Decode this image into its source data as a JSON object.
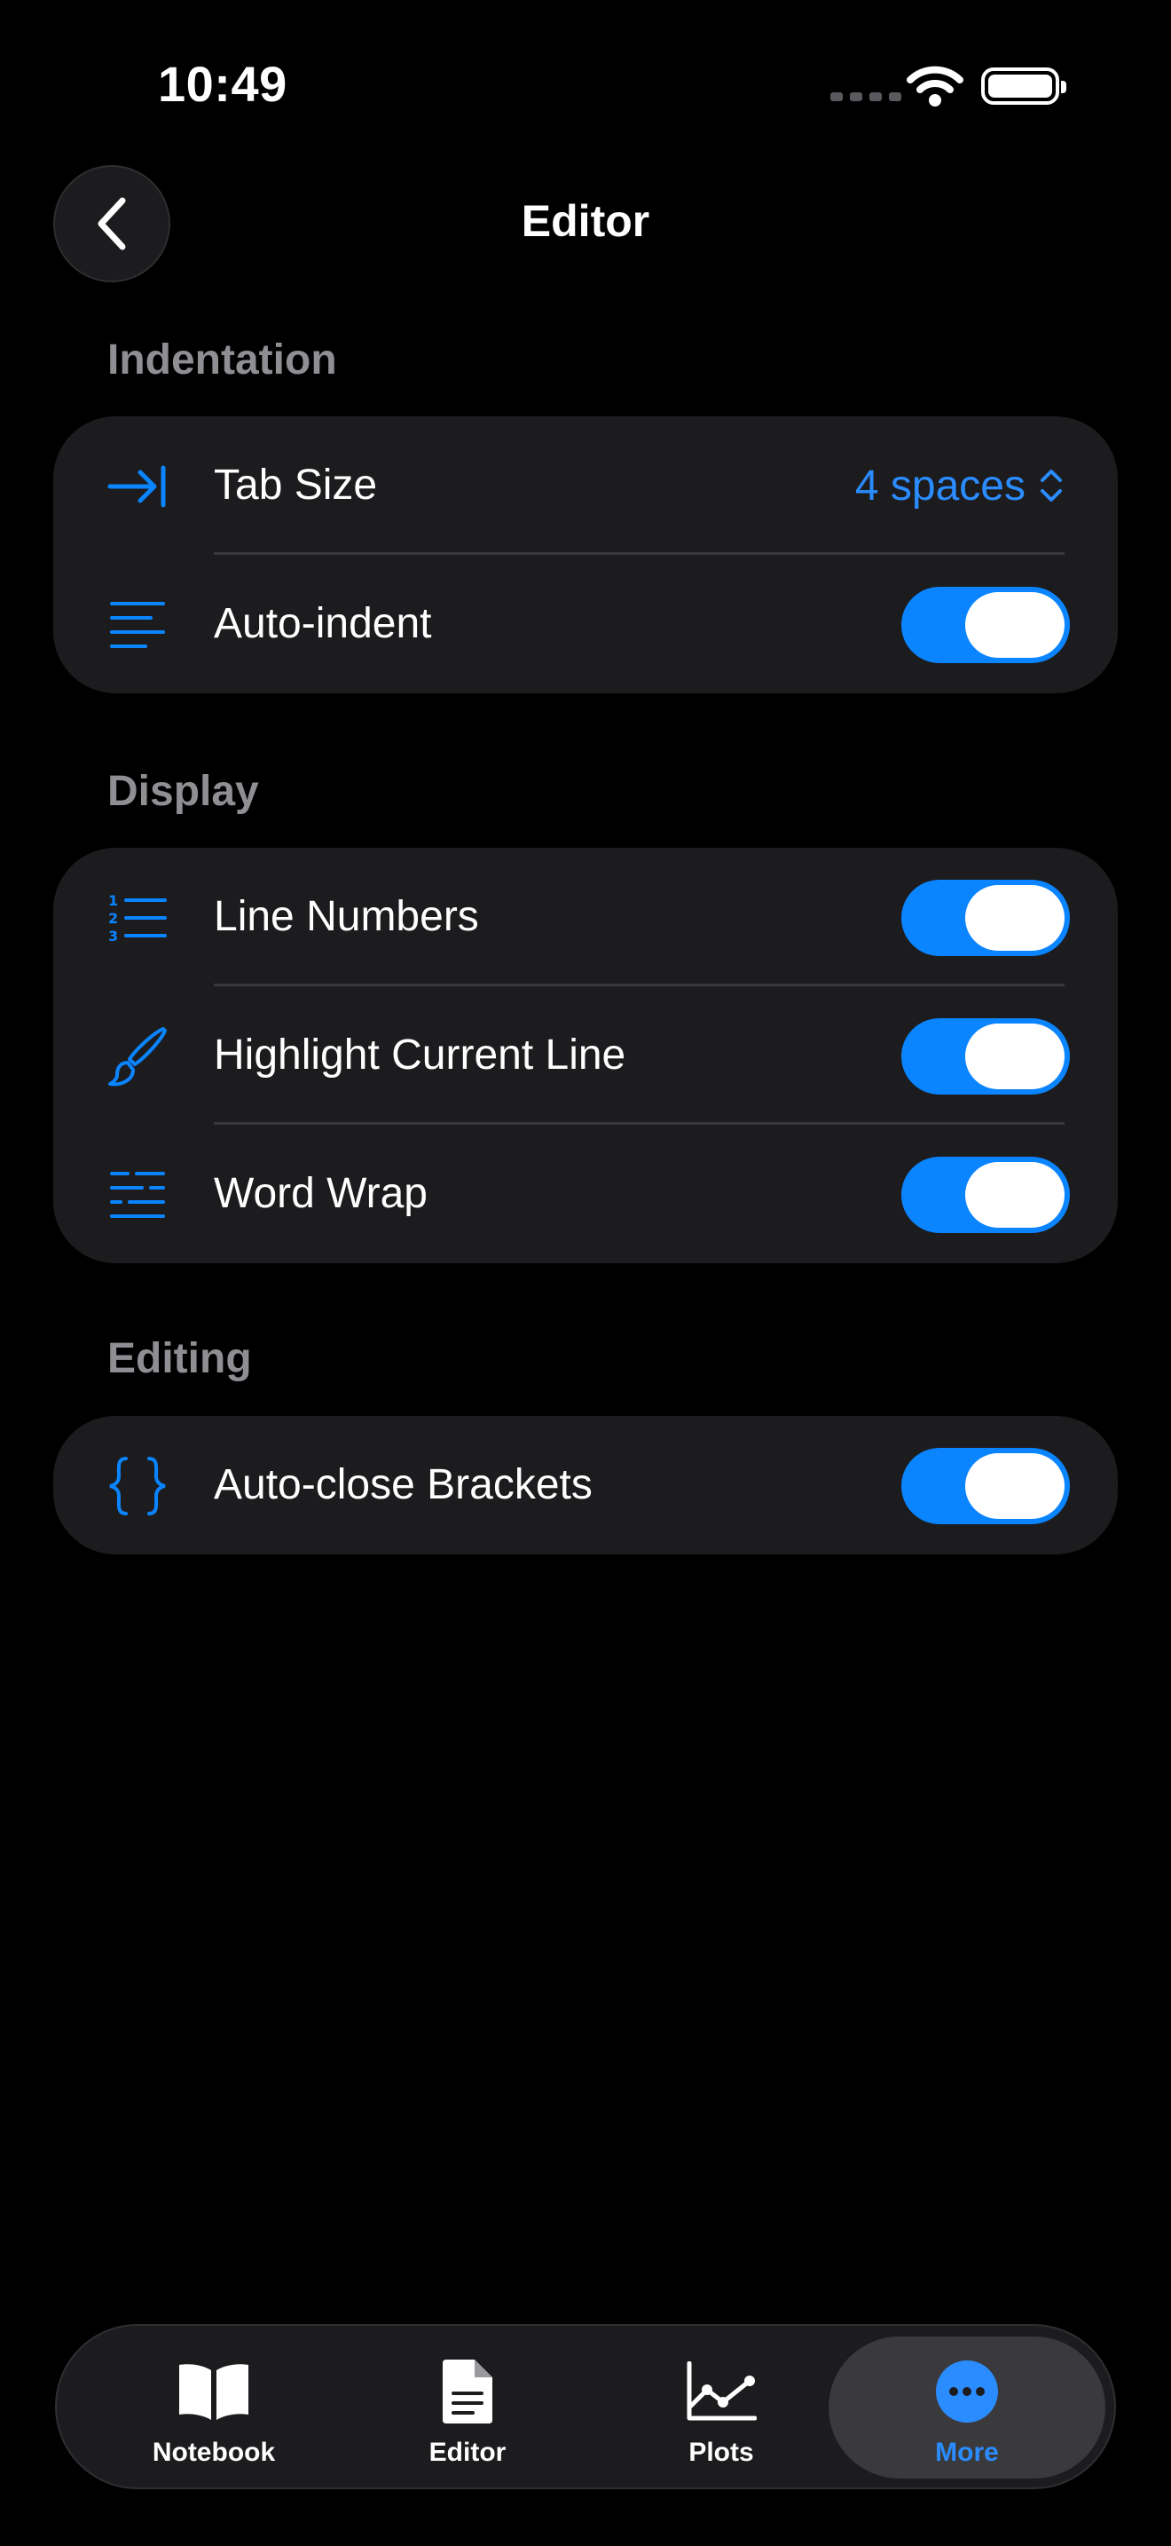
{
  "status_bar": {
    "time": "10:49"
  },
  "nav": {
    "title": "Editor",
    "back_icon": "chevron-left-icon"
  },
  "sections": [
    {
      "header": "Indentation",
      "rows": [
        {
          "icon": "indent-arrow-icon",
          "label": "Tab Size",
          "value": "4 spaces"
        },
        {
          "icon": "text-align-left-icon",
          "label": "Auto-indent",
          "toggle": true
        }
      ]
    },
    {
      "header": "Display",
      "rows": [
        {
          "icon": "numbered-list-icon",
          "label": "Line Numbers",
          "toggle": true
        },
        {
          "icon": "paintbrush-icon",
          "label": "Highlight Current Line",
          "toggle": true
        },
        {
          "icon": "word-wrap-icon",
          "label": "Word Wrap",
          "toggle": true
        }
      ]
    },
    {
      "header": "Editing",
      "rows": [
        {
          "icon": "curly-braces-icon",
          "label": "Auto-close Brackets",
          "toggle": true
        }
      ]
    }
  ],
  "tab_bar": {
    "items": [
      {
        "label": "Notebook",
        "icon": "book-icon"
      },
      {
        "label": "Editor",
        "icon": "document-icon"
      },
      {
        "label": "Plots",
        "icon": "chart-line-icon"
      },
      {
        "label": "More",
        "icon": "ellipsis-circle-icon",
        "active": true
      }
    ]
  },
  "colors": {
    "accent": "#0a84ff",
    "card": "#1c1c1e",
    "secondary_text": "#8e8e93"
  }
}
